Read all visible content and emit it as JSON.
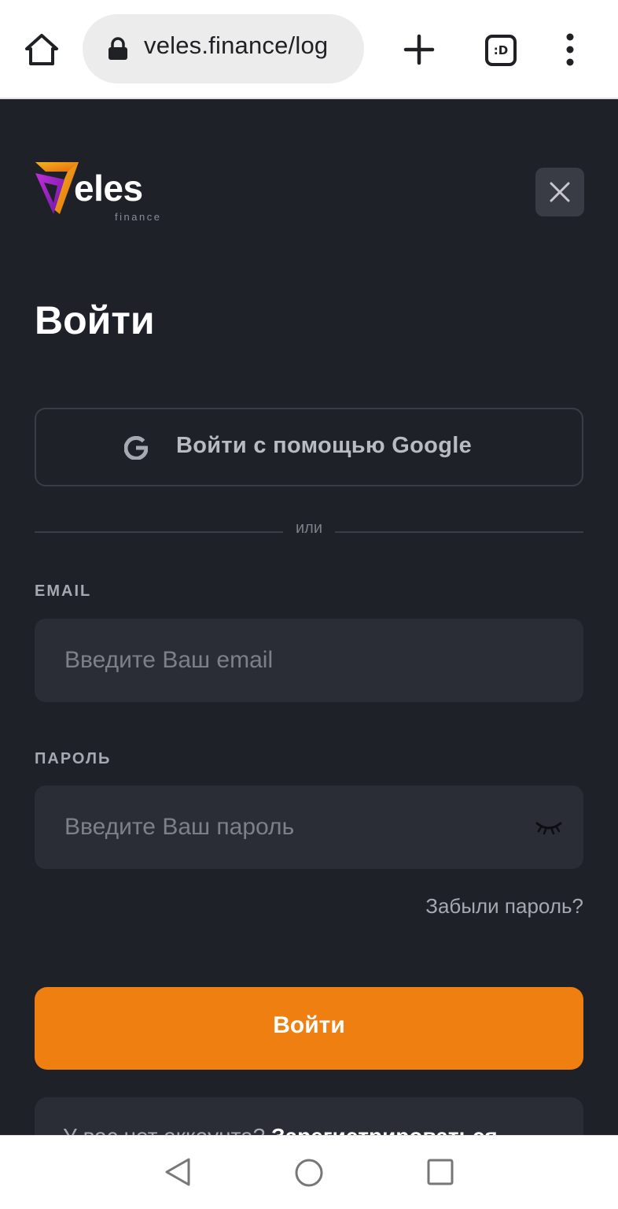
{
  "browser": {
    "url": "veles.finance/log",
    "tabs_label": ":D"
  },
  "logo": {
    "word": "eles",
    "sub": "finance"
  },
  "title": "Войти",
  "google_button": {
    "label": "Войти с помощью Google"
  },
  "divider": {
    "text": "или"
  },
  "email": {
    "label": "EMAIL",
    "placeholder": "Введите Ваш email",
    "value": ""
  },
  "password": {
    "label": "ПАРОЛЬ",
    "placeholder": "Введите Ваш пароль",
    "value": ""
  },
  "forgot_password": "Забыли пароль?",
  "submit": {
    "label": "Войти"
  },
  "register": {
    "text": "У вас нет аккаунта?",
    "link": "Зарегистрироваться"
  },
  "colors": {
    "background": "#1f2129",
    "input": "#2a2c36",
    "accent": "#ee7f10",
    "logo_gold": "#f2a51a",
    "logo_purple": "#9b22c9"
  }
}
